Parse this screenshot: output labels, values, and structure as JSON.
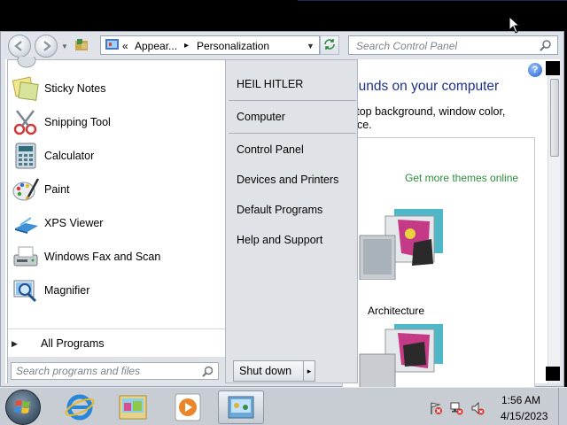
{
  "control_panel": {
    "address_prefix": "«",
    "address_crumb1": "Appear...",
    "address_sep": "▸",
    "address_crumb2": "Personalization",
    "search_placeholder": "Search Control Panel",
    "heading": "ounds on your computer",
    "desc_line1": "ctop background, window color,",
    "desc_line2": "nce.",
    "themes_link": "Get more themes online",
    "theme1_label": "Architecture",
    "help_icon": "help-icon"
  },
  "start_menu": {
    "programs": [
      {
        "label": "Sticky Notes",
        "icon": "sticky-notes-icon"
      },
      {
        "label": "Snipping Tool",
        "icon": "snipping-tool-icon"
      },
      {
        "label": "Calculator",
        "icon": "calculator-icon"
      },
      {
        "label": "Paint",
        "icon": "paint-icon"
      },
      {
        "label": "XPS Viewer",
        "icon": "xps-viewer-icon"
      },
      {
        "label": "Windows Fax and Scan",
        "icon": "fax-scan-icon"
      },
      {
        "label": "Magnifier",
        "icon": "magnifier-icon"
      }
    ],
    "all_programs": "All Programs",
    "search_placeholder": "Search programs and files",
    "right_items": {
      "user": "HEIL HITLER",
      "computer": "Computer",
      "control_panel": "Control Panel",
      "devices": "Devices and Printers",
      "default_programs": "Default Programs",
      "help": "Help and Support"
    },
    "shutdown": "Shut down",
    "shutdown_arrow": "▸"
  },
  "taskbar": {
    "time": "1:56 AM",
    "date": "4/15/2023",
    "pinned": [
      "internet-explorer-icon",
      "windows-explorer-icon",
      "media-player-icon",
      "control-panel-icon"
    ]
  },
  "colors": {
    "heading_blue": "#1e3287",
    "link_green": "#2c8d3e"
  }
}
